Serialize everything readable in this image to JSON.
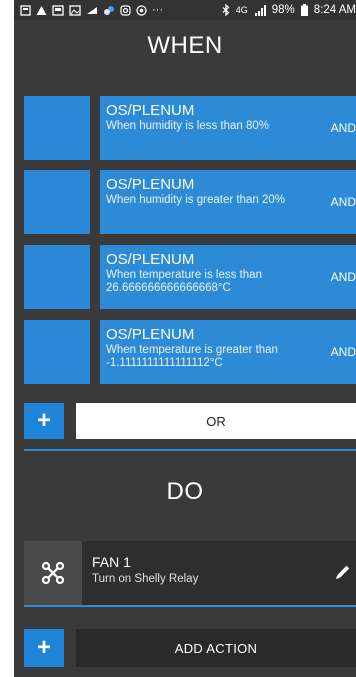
{
  "status_bar": {
    "battery": "98%",
    "time": "8:24 AM",
    "more": "···",
    "network": "4G",
    "icons": [
      "cast-icon",
      "warning-icon",
      "gallery-icon",
      "photo-icon",
      "signal-icon",
      "weather-icon",
      "instagram-icon",
      "chrome-icon",
      "more-icon",
      "bluetooth-icon",
      "network-icon",
      "signal-bars-icon",
      "battery-icon"
    ]
  },
  "when": {
    "title": "WHEN",
    "conditions": [
      {
        "title": "OS/PLENUM",
        "desc": "When humidity is less than 80%",
        "and": "AND"
      },
      {
        "title": "OS/PLENUM",
        "desc": "When humidity is greater than 20%",
        "and": "AND"
      },
      {
        "title": "OS/PLENUM",
        "desc": "When temperature is less than 26.666666666666668°C",
        "and": "AND"
      },
      {
        "title": "OS/PLENUM",
        "desc": "When temperature is greater than -1.1111111111111112°C",
        "and": "AND"
      }
    ],
    "add_plus": "+",
    "or_label": "OR"
  },
  "do": {
    "title": "DO",
    "action": {
      "title": "FAN 1",
      "desc": "Turn on Shelly Relay"
    },
    "add_plus": "+",
    "add_action_label": "ADD ACTION"
  },
  "colors": {
    "accent": "#2c8ad6",
    "background": "#3a3a3a",
    "or_button": "#ffffff"
  }
}
